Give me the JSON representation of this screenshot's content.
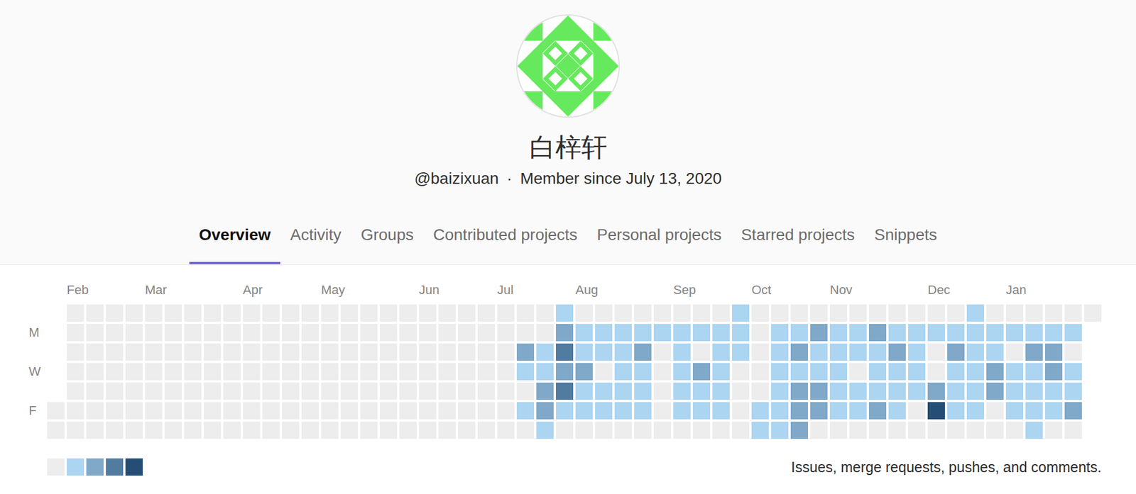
{
  "profile": {
    "name": "白梓轩",
    "username": "@baizixuan",
    "separator": "·",
    "member_since": "Member since July 13, 2020"
  },
  "tabs": [
    {
      "label": "Overview",
      "selected": true
    },
    {
      "label": "Activity",
      "selected": false
    },
    {
      "label": "Groups",
      "selected": false
    },
    {
      "label": "Contributed projects",
      "selected": false
    },
    {
      "label": "Personal projects",
      "selected": false
    },
    {
      "label": "Starred projects",
      "selected": false
    },
    {
      "label": "Snippets",
      "selected": false
    }
  ],
  "calendar": {
    "months": [
      {
        "label": "Feb",
        "week": 1
      },
      {
        "label": "Mar",
        "week": 5
      },
      {
        "label": "Apr",
        "week": 10
      },
      {
        "label": "May",
        "week": 14
      },
      {
        "label": "Jun",
        "week": 19
      },
      {
        "label": "Jul",
        "week": 23
      },
      {
        "label": "Aug",
        "week": 27
      },
      {
        "label": "Sep",
        "week": 32
      },
      {
        "label": "Oct",
        "week": 36
      },
      {
        "label": "Nov",
        "week": 40
      },
      {
        "label": "Dec",
        "week": 45
      },
      {
        "label": "Jan",
        "week": 49
      }
    ],
    "day_labels": [
      "",
      "M",
      "",
      "W",
      "",
      "F",
      ""
    ],
    "rows": [
      [
        null,
        0,
        0,
        0,
        0,
        0,
        0,
        0,
        0,
        0,
        0,
        0,
        0,
        0,
        0,
        0,
        0,
        0,
        0,
        0,
        0,
        0,
        0,
        0,
        0,
        0,
        1,
        0,
        0,
        0,
        0,
        0,
        0,
        0,
        0,
        1,
        0,
        0,
        0,
        0,
        0,
        0,
        0,
        0,
        0,
        0,
        0,
        1,
        0,
        0,
        0,
        0,
        0,
        0
      ],
      [
        null,
        0,
        0,
        0,
        0,
        0,
        0,
        0,
        0,
        0,
        0,
        0,
        0,
        0,
        0,
        0,
        0,
        0,
        0,
        0,
        0,
        0,
        0,
        0,
        0,
        0,
        2,
        1,
        1,
        1,
        1,
        1,
        1,
        1,
        1,
        1,
        0,
        1,
        1,
        2,
        1,
        1,
        2,
        1,
        1,
        1,
        1,
        1,
        1,
        1,
        1,
        1,
        1,
        null
      ],
      [
        null,
        0,
        0,
        0,
        0,
        0,
        0,
        0,
        0,
        0,
        0,
        0,
        0,
        0,
        0,
        0,
        0,
        0,
        0,
        0,
        0,
        0,
        0,
        0,
        2,
        1,
        3,
        1,
        1,
        1,
        2,
        0,
        1,
        0,
        1,
        1,
        0,
        1,
        2,
        1,
        1,
        1,
        1,
        2,
        1,
        0,
        2,
        1,
        1,
        0,
        2,
        2,
        0,
        null
      ],
      [
        null,
        0,
        0,
        0,
        0,
        0,
        0,
        0,
        0,
        0,
        0,
        0,
        0,
        0,
        0,
        0,
        0,
        0,
        0,
        0,
        0,
        0,
        0,
        0,
        1,
        1,
        2,
        2,
        0,
        1,
        1,
        0,
        1,
        2,
        1,
        0,
        0,
        1,
        1,
        1,
        1,
        0,
        1,
        1,
        1,
        0,
        1,
        1,
        2,
        1,
        1,
        2,
        1,
        null
      ],
      [
        null,
        0,
        0,
        0,
        0,
        0,
        0,
        0,
        0,
        0,
        0,
        0,
        0,
        0,
        0,
        0,
        0,
        0,
        0,
        0,
        0,
        0,
        0,
        0,
        0,
        2,
        3,
        1,
        1,
        1,
        1,
        0,
        1,
        1,
        1,
        0,
        0,
        1,
        2,
        2,
        1,
        1,
        1,
        1,
        1,
        2,
        1,
        1,
        2,
        1,
        1,
        1,
        1,
        null
      ],
      [
        0,
        0,
        0,
        0,
        0,
        0,
        0,
        0,
        0,
        0,
        0,
        0,
        0,
        0,
        0,
        0,
        0,
        0,
        0,
        0,
        0,
        0,
        0,
        0,
        1,
        2,
        1,
        1,
        1,
        1,
        1,
        0,
        1,
        1,
        1,
        0,
        1,
        1,
        2,
        2,
        1,
        1,
        2,
        1,
        0,
        4,
        1,
        1,
        0,
        1,
        1,
        1,
        2,
        null
      ],
      [
        0,
        0,
        0,
        0,
        0,
        0,
        0,
        0,
        0,
        0,
        0,
        0,
        0,
        0,
        0,
        0,
        0,
        0,
        0,
        0,
        0,
        0,
        0,
        0,
        0,
        1,
        0,
        0,
        0,
        0,
        0,
        0,
        0,
        0,
        0,
        0,
        1,
        1,
        2,
        0,
        0,
        0,
        0,
        0,
        0,
        0,
        0,
        0,
        0,
        0,
        1,
        0,
        0,
        null
      ]
    ],
    "legend": [
      {
        "intensity": 0
      },
      {
        "intensity": 1
      },
      {
        "intensity": 2
      },
      {
        "intensity": 3
      },
      {
        "intensity": 4
      }
    ],
    "legend_text": "Issues, merge requests, pushes, and comments."
  }
}
